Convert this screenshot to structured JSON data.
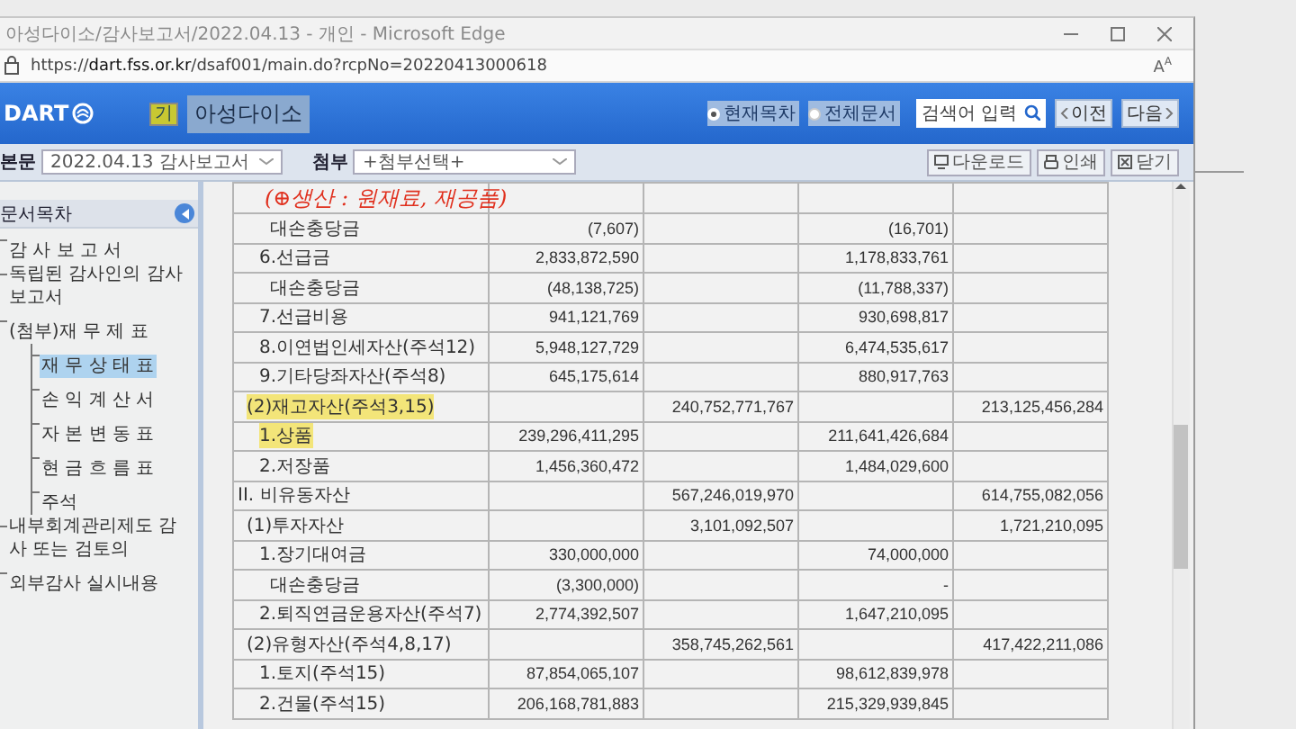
{
  "window": {
    "title": "아성다이소/감사보고서/2022.04.13 - 개인 - Microsoft Edge"
  },
  "address_bar": {
    "url_prefix": "https://",
    "url_host": "dart.fss.or.kr",
    "url_path": "/dsaf001/main.do?rcpNo=20220413000618",
    "read_aloud": "A$^{A}$"
  },
  "header": {
    "logo": "DART",
    "company_badge": "기",
    "company": "아성다이소",
    "scope_options": [
      {
        "label": "현재목차",
        "selected": true
      },
      {
        "label": "전체문서",
        "selected": false
      }
    ],
    "search": {
      "placeholder": "검색어 입력"
    },
    "prev_button": "이전",
    "next_button": "다음"
  },
  "toolbar": {
    "main_label": "본문",
    "main_select": "2022.04.13 감사보고서",
    "attach_label": "첨부",
    "attach_select": "+첨부선택+",
    "buttons": [
      {
        "kind": "download",
        "label": "다운로드"
      },
      {
        "kind": "print",
        "label": "인쇄"
      },
      {
        "kind": "close",
        "label": "닫기"
      }
    ]
  },
  "sidebar": {
    "title": "문서목차",
    "items": [
      {
        "label": "감 사 보 고 서",
        "selected": false
      },
      {
        "label": "독립된 감사인의 감사보고서",
        "selected": false
      },
      {
        "label": "(첨부)재 무 제 표",
        "selected": false,
        "expanded": true,
        "children": [
          {
            "label": "재 무 상 태 표",
            "selected": true
          },
          {
            "label": "손 익 계 산 서",
            "selected": false
          },
          {
            "label": "자 본 변 동 표",
            "selected": false
          },
          {
            "label": "현 금 흐 름 표",
            "selected": false
          },
          {
            "label": "주석",
            "selected": false
          }
        ]
      },
      {
        "label": "내부회계관리제도 감사 또는 검토의",
        "selected": false
      },
      {
        "label": "외부감사 실시내용",
        "selected": false
      }
    ]
  },
  "annotation": "(⊕생산 : 원재료, 재공품)",
  "statement": {
    "rows": [
      {
        "kind": "allowance",
        "label": "대손충당금",
        "highlighted": false,
        "col_2": "(7,607)",
        "col_4": "(16,701)"
      },
      {
        "kind": "item",
        "label": "6.선급금",
        "highlighted": false,
        "col_2": "2,833,872,590",
        "col_4": "1,178,833,761"
      },
      {
        "kind": "allowance",
        "label": "대손충당금",
        "highlighted": false,
        "col_2": "(48,138,725)",
        "col_4": "(11,788,337)"
      },
      {
        "kind": "item",
        "label": "7.선급비용",
        "highlighted": false,
        "col_2": "941,121,769",
        "col_4": "930,698,817"
      },
      {
        "kind": "item",
        "label": "8.이연법인세자산(주석12)",
        "highlighted": false,
        "col_2": "5,948,127,729",
        "col_4": "6,474,535,617"
      },
      {
        "kind": "item",
        "label": "9.기타당좌자산(주석8)",
        "highlighted": false,
        "col_2": "645,175,614",
        "col_4": "880,917,763"
      },
      {
        "kind": "group",
        "label": "(2)재고자산(주석3,15)",
        "highlighted": true,
        "col_3": "240,752,771,767",
        "col_5": "213,125,456,284"
      },
      {
        "kind": "item",
        "label": "1.상품",
        "highlighted": true,
        "col_2": "239,296,411,295",
        "col_4": "211,641,426,684"
      },
      {
        "kind": "item",
        "label": "2.저장품",
        "highlighted": false,
        "col_2": "1,456,360,472",
        "col_4": "1,484,029,600"
      },
      {
        "kind": "heading",
        "label": "II. 비유동자산",
        "highlighted": false,
        "col_3": "567,246,019,970",
        "col_5": "614,755,082,056"
      },
      {
        "kind": "group",
        "label": "(1)투자자산",
        "highlighted": false,
        "col_3": "3,101,092,507",
        "col_5": "1,721,210,095"
      },
      {
        "kind": "item",
        "label": "1.장기대여금",
        "highlighted": false,
        "col_2": "330,000,000",
        "col_4": "74,000,000"
      },
      {
        "kind": "allowance",
        "label": "대손충당금",
        "highlighted": false,
        "col_2": "(3,300,000)",
        "col_4": "-"
      },
      {
        "kind": "item",
        "label": "2.퇴직연금운용자산(주석7)",
        "highlighted": false,
        "col_2": "2,774,392,507",
        "col_4": "1,647,210,095"
      },
      {
        "kind": "group",
        "label": "(2)유형자산(주석4,8,17)",
        "highlighted": false,
        "col_3": "358,745,262,561",
        "col_5": "417,422,211,086"
      },
      {
        "kind": "item",
        "label": "1.토지(주석15)",
        "highlighted": false,
        "col_2": "87,854,065,107",
        "col_4": "98,612,839,978"
      },
      {
        "kind": "item",
        "label": "2.건물(주석15)",
        "highlighted": false,
        "col_2": "206,168,781,883",
        "col_4": "215,329,939,845"
      }
    ]
  }
}
